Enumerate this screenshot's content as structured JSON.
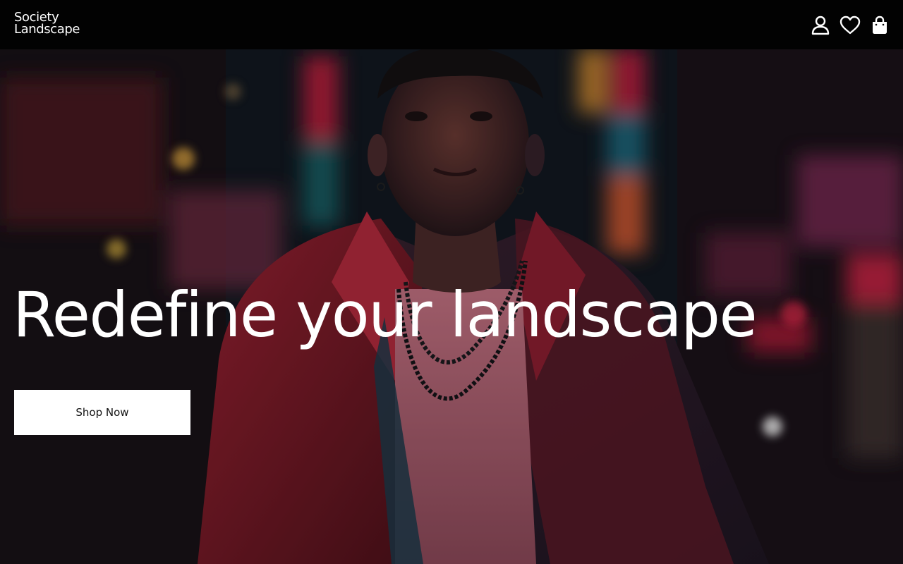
{
  "brand": {
    "line1": "Society",
    "line2": "Landscape"
  },
  "header": {
    "icons": [
      "user-icon",
      "heart-icon",
      "shopping-bag-icon"
    ]
  },
  "hero": {
    "headline": "Redefine your landscape",
    "cta_label": "Shop Now"
  },
  "colors": {
    "header_bg": "#020202",
    "text": "#ffffff",
    "button_bg": "#ffffff",
    "button_text": "#111111",
    "neon_red": "#e0284a",
    "jacket_red": "#8a1c2a"
  }
}
